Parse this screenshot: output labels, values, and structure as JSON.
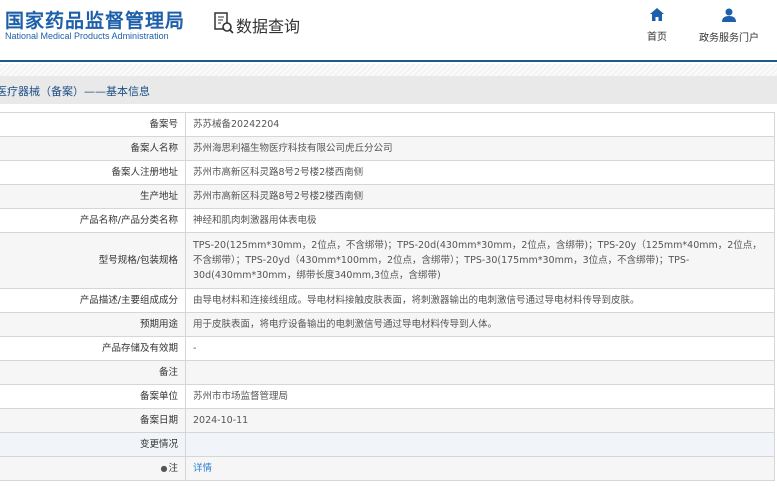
{
  "header": {
    "logo_cn": "国家药品监督管理局",
    "logo_en": "National Medical Products Administration",
    "query_title": "数据查询",
    "nav": [
      {
        "label": "首页",
        "icon": "home-icon"
      },
      {
        "label": "政务服务门户",
        "icon": "user-icon"
      }
    ]
  },
  "breadcrumb": "医疗器械（备案）——基本信息",
  "rows": [
    {
      "label": "备案号",
      "value": "苏苏械备20242204"
    },
    {
      "label": "备案人名称",
      "value": "苏州海思利福生物医疗科技有限公司虎丘分公司"
    },
    {
      "label": "备案人注册地址",
      "value": "苏州市高新区科灵路8号2号楼2楼西南侧"
    },
    {
      "label": "生产地址",
      "value": "苏州市高新区科灵路8号2号楼2楼西南侧"
    },
    {
      "label": "产品名称/产品分类名称",
      "value": "神经和肌肉刺激器用体表电极"
    },
    {
      "label": "型号规格/包装规格",
      "value": "TPS-20(125mm*30mm，2位点，不含绑带)；TPS-20d(430mm*30mm，2位点，含绑带)；TPS-20y（125mm*40mm，2位点，不含绑带）；TPS-20yd（430mm*100mm，2位点，含绑带）；TPS-30(175mm*30mm，3位点，不含绑带)；TPS-30d(430mm*30mm，绑带长度340mm,3位点，含绑带)"
    },
    {
      "label": "产品描述/主要组成成分",
      "value": "由导电材料和连接线组成。导电材料接触皮肤表面，将刺激器输出的电刺激信号通过导电材料传导到皮肤。"
    },
    {
      "label": "预期用途",
      "value": "用于皮肤表面，将电疗设备输出的电刺激信号通过导电材料传导到人体。"
    },
    {
      "label": "产品存储及有效期",
      "value": "-"
    },
    {
      "label": "备注",
      "value": ""
    },
    {
      "label": "备案单位",
      "value": "苏州市市场监督管理局"
    },
    {
      "label": "备案日期",
      "value": "2024-10-11"
    },
    {
      "label": "变更情况",
      "value": ""
    },
    {
      "label": "注",
      "value": "详情"
    }
  ]
}
